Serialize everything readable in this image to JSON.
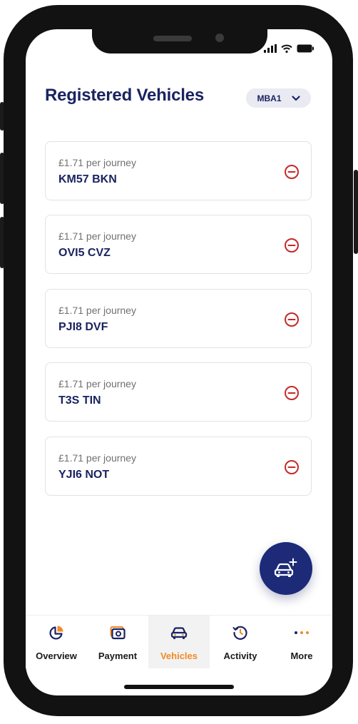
{
  "header": {
    "title": "Registered Vehicles",
    "account_selector": "MBA1"
  },
  "vehicles": [
    {
      "price": "£1.71 per journey",
      "plate": "KM57 BKN"
    },
    {
      "price": "£1.71 per journey",
      "plate": "OVI5 CVZ"
    },
    {
      "price": "£1.71 per journey",
      "plate": "PJI8 DVF"
    },
    {
      "price": "£1.71 per journey",
      "plate": "T3S TIN"
    },
    {
      "price": "£1.71 per journey",
      "plate": "YJI6 NOT"
    }
  ],
  "fab": {
    "icon": "add-vehicle-icon"
  },
  "tabs": [
    {
      "label": "Overview",
      "icon": "pie-chart-icon",
      "active": false
    },
    {
      "label": "Payment",
      "icon": "wallet-icon",
      "active": false
    },
    {
      "label": "Vehicles",
      "icon": "car-icon",
      "active": true
    },
    {
      "label": "Activity",
      "icon": "history-icon",
      "active": false
    },
    {
      "label": "More",
      "icon": "more-dots-icon",
      "active": false
    }
  ],
  "colors": {
    "primary": "#1a2361",
    "accent": "#f08a24",
    "remove": "#c62828",
    "fab": "#1c2a78"
  }
}
